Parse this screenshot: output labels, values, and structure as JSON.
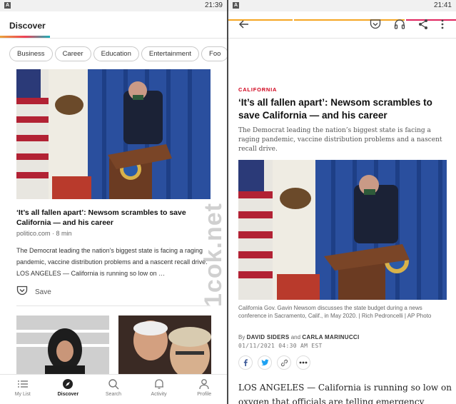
{
  "left": {
    "status_time": "21:39",
    "status_letter": "A",
    "header_title": "Discover",
    "categories": [
      "Business",
      "Career",
      "Education",
      "Entertainment",
      "Foo"
    ],
    "story": {
      "headline": "‘It’s all fallen apart’: Newsom scrambles to save California — and his career",
      "source": "politico.com · 8 min",
      "excerpt": "The Democrat leading the nation’s biggest state is facing a raging pandemic, vaccine distribution problems and a nascent recall drive. LOS ANGELES — California is running so low on …",
      "save_label": "Save"
    },
    "tabs": [
      {
        "label": "My List",
        "icon": "list-icon"
      },
      {
        "label": "Discover",
        "icon": "discover-icon"
      },
      {
        "label": "Search",
        "icon": "search-icon"
      },
      {
        "label": "Activity",
        "icon": "bell-icon"
      },
      {
        "label": "Profile",
        "icon": "profile-icon"
      }
    ]
  },
  "right": {
    "status_time": "21:41",
    "status_letter": "A",
    "kicker": "CALIFORNIA",
    "headline": "‘It’s all fallen apart’: Newsom scrambles to save California — and his career",
    "dek": "The Democrat leading the nation’s biggest state is facing a raging pandemic, vaccine distribution problems and a nascent recall drive.",
    "caption": "California Gov. Gavin Newsom discusses the state budget during a news conference in Sacramento, Calif., in May 2020. | Rich Pedroncelli | AP Photo",
    "byline_prefix": "By",
    "author1": "DAVID SIDERS",
    "byline_and": "and",
    "author2": "CARLA MARINUCCI",
    "date": "01/11/2021 04:30 AM EST",
    "body": "LOS ANGELES — California is running so low on oxygen that officials are telling emergency crews"
  },
  "watermark": "1cok.net",
  "colors": {
    "accent_red": "#d0021b",
    "facebook": "#3b5998",
    "twitter": "#1da1f2",
    "strip_yellow": "#f5a623",
    "strip_red": "#e0245e"
  }
}
